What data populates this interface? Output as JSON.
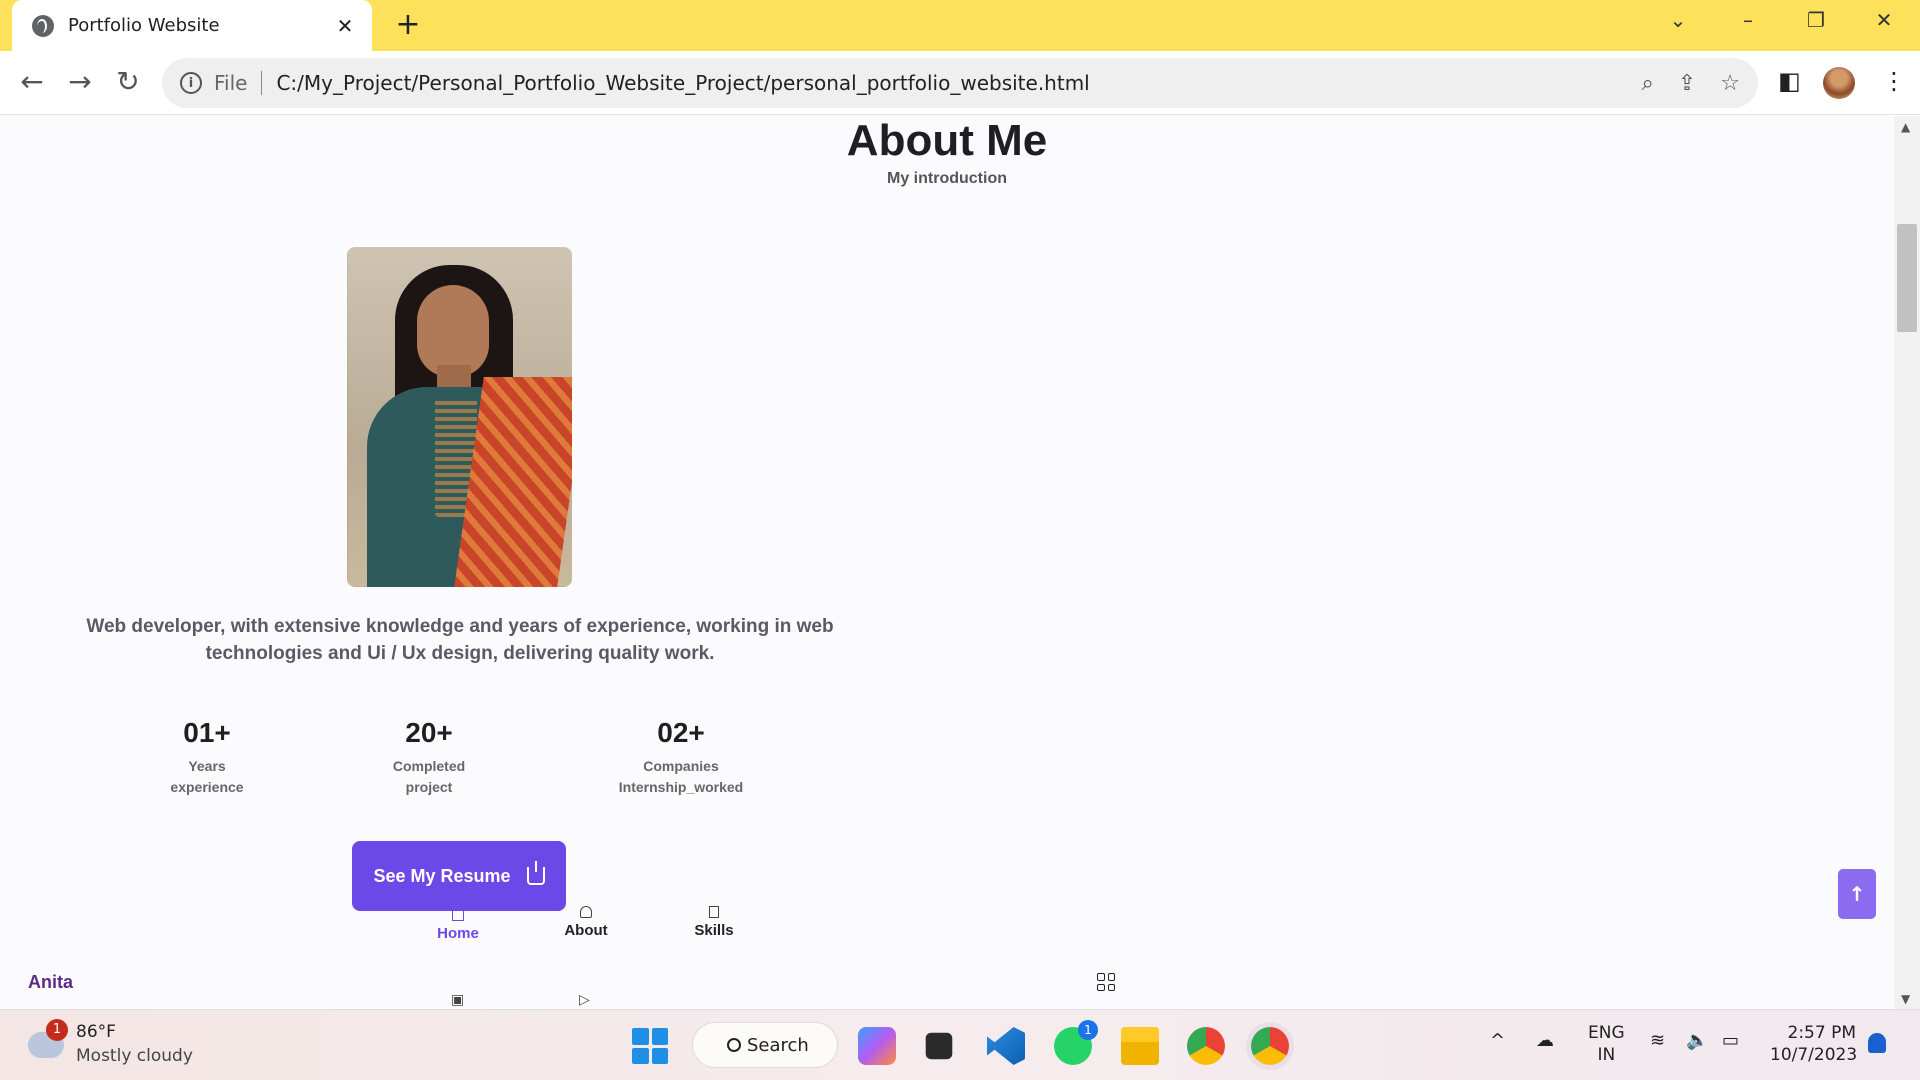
{
  "browser": {
    "tab_title": "Portfolio Website",
    "tab_close": "✕",
    "new_tab": "+",
    "file_label": "File",
    "url": "C:/My_Project/Personal_Portfolio_Website_Project/personal_portfolio_website.html",
    "icons": [
      "globe-icon",
      "back-icon",
      "forward-icon",
      "reload-icon",
      "info-icon",
      "zoom-icon",
      "share-icon",
      "star-icon",
      "sidepanel-icon",
      "profile-avatar",
      "menu-icon"
    ]
  },
  "page": {
    "title": "About Me",
    "subtitle": "My introduction",
    "description": "Web developer, with extensive knowledge and years of experience, working in web technologies and Ui / Ux design, delivering quality work.",
    "stats": [
      {
        "number": "01+",
        "label_line1": "Years",
        "label_line2": "experience"
      },
      {
        "number": "20+",
        "label_line1": "Completed",
        "label_line2": "project"
      },
      {
        "number": "02+",
        "label_line1": "Companies",
        "label_line2": "Internship_worked"
      }
    ],
    "resume_button": "See My Resume",
    "nav": {
      "home": "Home",
      "about": "About",
      "skills": "Skills"
    },
    "brand": "Anita",
    "accent_color": "#6b48e8"
  },
  "taskbar": {
    "weather_badge": "1",
    "weather_temp": "86°F",
    "weather_desc": "Mostly cloudy",
    "search": "Search",
    "whatsapp_badge": "1",
    "lang_line1": "ENG",
    "lang_line2": "IN",
    "time": "2:57 PM",
    "date": "10/7/2023"
  }
}
